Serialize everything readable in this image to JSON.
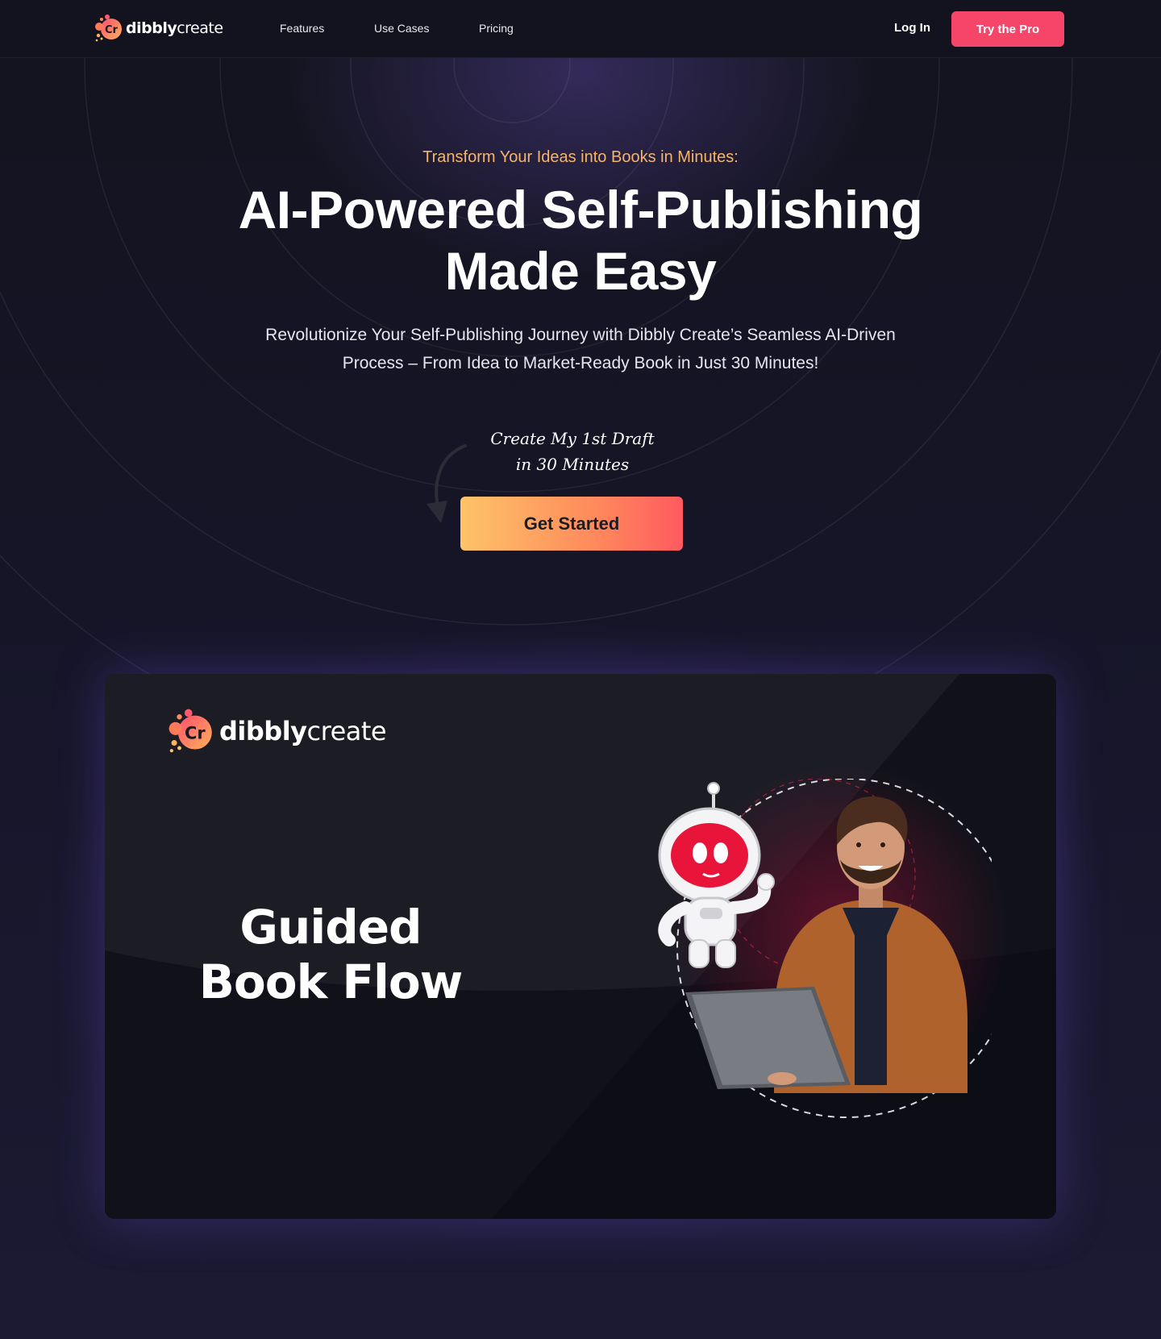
{
  "nav": {
    "logo_bold": "dibbly",
    "logo_light": "create",
    "links": [
      "Features",
      "Use Cases",
      "Pricing"
    ],
    "login_label": "Log In",
    "cta_label": "Try the Pro"
  },
  "hero": {
    "eyebrow": "Transform Your Ideas into Books in Minutes:",
    "headline_line1": "AI-Powered Self-Publishing",
    "headline_line2": "Made Easy",
    "subhead": "Revolutionize Your Self-Publishing Journey with Dibbly Create’s Seamless AI-Driven Process – From Idea to Market-Ready Book in Just 30 Minutes!",
    "note_line1": "Create My 1st Draft",
    "note_line2": "in 30 Minutes",
    "cta_label": "Get Started"
  },
  "video_card": {
    "logo_bold": "dibbly",
    "logo_light": "create",
    "title_line1": "Guided",
    "title_line2": "Book Flow"
  },
  "colors": {
    "accent_pink": "#f5466a",
    "eyebrow_orange": "#f6b46a",
    "cta_gradient_start": "#fec468",
    "cta_gradient_end": "#ff5a5f",
    "page_background": "#12121c"
  },
  "icons": {
    "logo": "dibbly-logo-icon",
    "arrow": "curved-arrow-icon",
    "robot": "robot-mascot-icon",
    "person": "person-with-laptop-illustration"
  }
}
